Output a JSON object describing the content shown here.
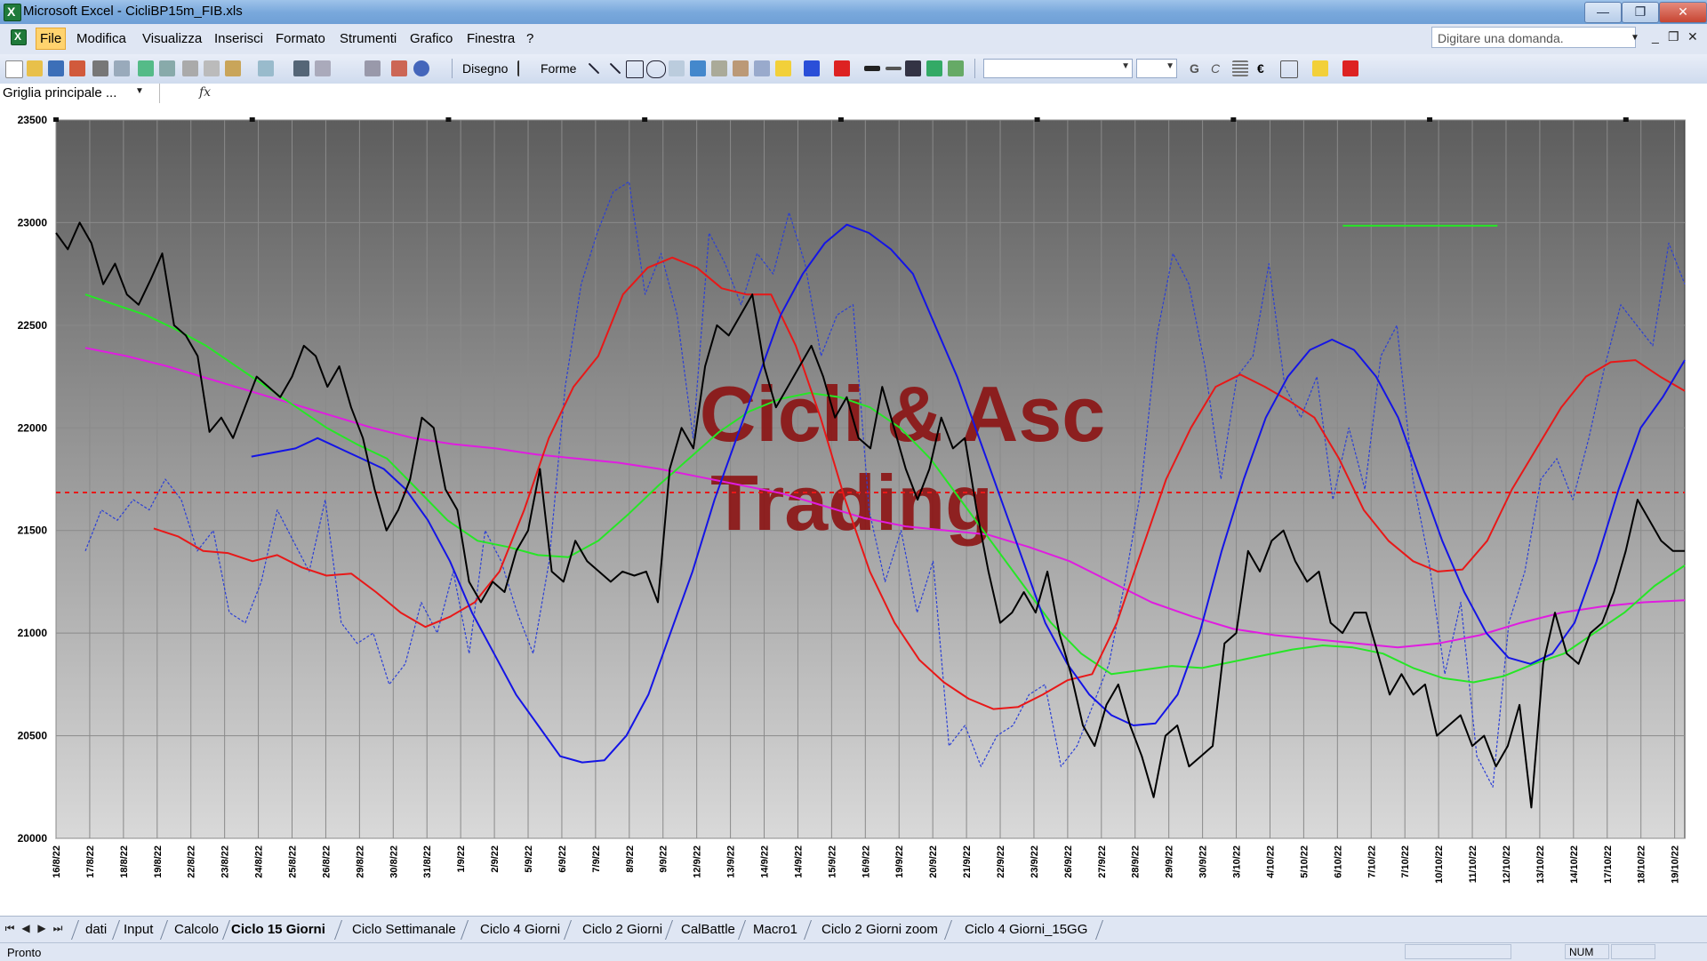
{
  "window": {
    "title": "Microsoft Excel - CicliBP15m_FIB.xls",
    "minimize": "—",
    "restore": "❐",
    "close": "✕"
  },
  "menu": {
    "items": [
      "File",
      "Modifica",
      "Visualizza",
      "Inserisci",
      "Formato",
      "Strumenti",
      "Grafico",
      "Finestra",
      "?"
    ],
    "help_placeholder": "Digitare una domanda."
  },
  "toolbar": {
    "draw_label": "Disegno",
    "shapes_label": "Forme",
    "bold": "G",
    "italic": "C",
    "euro": "€"
  },
  "formula_bar": {
    "name_box": "Griglia principale ...",
    "fx": "fx"
  },
  "chart_data": {
    "type": "line",
    "ylim": [
      20000,
      23500
    ],
    "yticks": [
      20000,
      20500,
      21000,
      21500,
      22000,
      22500,
      23000,
      23500
    ],
    "xlabels": [
      "16/8/22",
      "17/8/22",
      "18/8/22",
      "19/8/22",
      "22/8/22",
      "23/8/22",
      "24/8/22",
      "25/8/22",
      "26/8/22",
      "29/8/22",
      "30/8/22",
      "31/8/22",
      "1/9/22",
      "2/9/22",
      "5/9/22",
      "6/9/22",
      "7/9/22",
      "8/9/22",
      "9/9/22",
      "12/9/22",
      "13/9/22",
      "14/9/22",
      "14/9/22",
      "15/9/22",
      "16/9/22",
      "19/9/22",
      "20/9/22",
      "21/9/22",
      "22/9/22",
      "23/9/22",
      "26/9/22",
      "27/9/22",
      "28/9/22",
      "29/9/22",
      "30/9/22",
      "3/10/22",
      "4/10/22",
      "5/10/22",
      "6/10/22",
      "7/10/22",
      "7/10/22",
      "10/10/22",
      "11/10/22",
      "12/10/22",
      "13/10/22",
      "14/10/22",
      "17/10/22",
      "18/10/22",
      "19/10/22"
    ],
    "watermark": [
      "Cicli & Asc",
      "Trading"
    ],
    "reference_level": 21685,
    "colors": {
      "price": "#000000",
      "oscillator": "#2b3fd6",
      "blue": "#1414e6",
      "red": "#e81818",
      "green": "#26e626",
      "magenta": "#e01ce0",
      "watermark": "#8b0b0b"
    },
    "grid": true,
    "series": [
      {
        "key": "price",
        "style": "solid",
        "values": [
          22950,
          22870,
          23000,
          22900,
          22700,
          22800,
          22650,
          22600,
          22720,
          22850,
          22500,
          22450,
          22350,
          21980,
          22050,
          21950,
          22100,
          22250,
          22200,
          22150,
          22250,
          22400,
          22350,
          22200,
          22300,
          22100,
          21950,
          21700,
          21500,
          21600,
          21750,
          22050,
          22000,
          21700,
          21600,
          21250,
          21150,
          21250,
          21200,
          21400,
          21500,
          21800,
          21300,
          21250,
          21450,
          21350,
          21300,
          21250,
          21300,
          21280,
          21300,
          21150,
          21800,
          22000,
          21900,
          22300,
          22500,
          22450,
          22550,
          22650,
          22300,
          22100,
          22200,
          22300,
          22400,
          22250,
          22050,
          22150,
          21950,
          21900,
          22200,
          22000,
          21800,
          21650,
          21800,
          22050,
          21900,
          21950,
          21600,
          21300,
          21050,
          21100,
          21200,
          21100,
          21300,
          21000,
          20800,
          20550,
          20450,
          20650,
          20750,
          20550,
          20400,
          20200,
          20500,
          20550,
          20350,
          20400,
          20450,
          20950,
          21000,
          21400,
          21300,
          21450,
          21500,
          21350,
          21250,
          21300,
          21050,
          21000,
          21100,
          21100,
          20900,
          20700,
          20800,
          20700,
          20750,
          20500,
          20550,
          20600,
          20450,
          20500,
          20350,
          20450,
          20650,
          20150,
          20850,
          21100,
          20900,
          20850,
          21000,
          21050,
          21200,
          21400,
          21650,
          21550,
          21450,
          21400,
          21400
        ]
      },
      {
        "key": "oscillator",
        "style": "dashed",
        "values": [
          21400,
          21600,
          21550,
          21650,
          21600,
          21750,
          21650,
          21400,
          21500,
          21100,
          21050,
          21250,
          21600,
          21450,
          21300,
          21650,
          21050,
          20950,
          21000,
          20750,
          20850,
          21150,
          21000,
          21300,
          20900,
          21500,
          21350,
          21100,
          20900,
          21350,
          22200,
          22700,
          22950,
          23150,
          23200,
          22650,
          22850,
          22550,
          21950,
          22950,
          22800,
          22600,
          22850,
          22750,
          23050,
          22800,
          22350,
          22550,
          22600,
          21600,
          21250,
          21500,
          21100,
          21350,
          20450,
          20550,
          20350,
          20500,
          20550,
          20700,
          20750,
          20350,
          20450,
          20650,
          20850,
          21250,
          21700,
          22450,
          22850,
          22700,
          22300,
          21750,
          22250,
          22350,
          22800,
          22200,
          22050,
          22250,
          21650,
          22000,
          21700,
          22350,
          22500,
          21750,
          21350,
          20800,
          21150,
          20400,
          20250,
          21050,
          21300,
          21750,
          21850,
          21650,
          21950,
          22300,
          22600,
          22500,
          22400,
          22900,
          22700
        ]
      },
      {
        "key": "blue",
        "style": "solid",
        "values": [
          21860,
          21880,
          21900,
          21950,
          21900,
          21850,
          21800,
          21700,
          21550,
          21350,
          21100,
          20900,
          20700,
          20550,
          20400,
          20370,
          20380,
          20500,
          20700,
          21000,
          21300,
          21650,
          21950,
          22250,
          22550,
          22750,
          22900,
          22990,
          22950,
          22870,
          22750,
          22500,
          22250,
          21950,
          21650,
          21350,
          21050,
          20850,
          20700,
          20600,
          20550,
          20560,
          20700,
          21000,
          21400,
          21750,
          22050,
          22250,
          22380,
          22430,
          22380,
          22250,
          22050,
          21750,
          21450,
          21200,
          21000,
          20880,
          20850,
          20900,
          21050,
          21350,
          21700,
          22000,
          22150,
          22330
        ]
      },
      {
        "key": "red",
        "style": "solid",
        "values": [
          21510,
          21470,
          21400,
          21390,
          21350,
          21380,
          21320,
          21280,
          21290,
          21200,
          21100,
          21030,
          21080,
          21150,
          21300,
          21600,
          21950,
          22200,
          22350,
          22650,
          22780,
          22830,
          22780,
          22680,
          22650,
          22650,
          22400,
          22050,
          21650,
          21300,
          21050,
          20870,
          20760,
          20680,
          20630,
          20640,
          20700,
          20770,
          20800,
          21050,
          21400,
          21750,
          22000,
          22200,
          22260,
          22200,
          22130,
          22050,
          21850,
          21600,
          21450,
          21350,
          21300,
          21310,
          21450,
          21700,
          21900,
          22100,
          22250,
          22320,
          22330,
          22250,
          22180
        ]
      },
      {
        "key": "green",
        "style": "solid",
        "values": [
          22650,
          22600,
          22550,
          22480,
          22400,
          22300,
          22200,
          22100,
          22000,
          21920,
          21850,
          21700,
          21550,
          21450,
          21420,
          21380,
          21370,
          21450,
          21580,
          21720,
          21850,
          21980,
          22080,
          22140,
          22170,
          22150,
          22100,
          22000,
          21850,
          21650,
          21450,
          21250,
          21050,
          20900,
          20800,
          20820,
          20840,
          20830,
          20860,
          20890,
          20920,
          20940,
          20930,
          20900,
          20830,
          20780,
          20760,
          20790,
          20850,
          20900,
          21000,
          21100,
          21230,
          21330
        ]
      },
      {
        "key": "green_short",
        "style": "solid",
        "values": [
          22985,
          22985
        ]
      },
      {
        "key": "magenta",
        "style": "solid",
        "values": [
          22390,
          22350,
          22300,
          22240,
          22180,
          22120,
          22060,
          22000,
          21950,
          21920,
          21900,
          21870,
          21850,
          21830,
          21800,
          21760,
          21720,
          21680,
          21620,
          21560,
          21520,
          21500,
          21480,
          21420,
          21350,
          21250,
          21150,
          21080,
          21020,
          20990,
          20970,
          20950,
          20930,
          20950,
          20990,
          21050,
          21100,
          21130,
          21150,
          21160
        ]
      }
    ]
  },
  "sheet_tabs": {
    "nav": [
      "⏮",
      "◀",
      "▶",
      "⏭"
    ],
    "items": [
      "dati",
      "Input",
      "Calcolo",
      "Ciclo 15 Giorni",
      "Ciclo Settimanale",
      "Ciclo 4 Giorni",
      "Ciclo 2 Giorni",
      "CalBattle",
      "Macro1",
      "Ciclo 2 Giorni zoom",
      "Ciclo 4 Giorni_15GG"
    ],
    "active": "Ciclo 15 Giorni"
  },
  "status": {
    "text": "Pronto",
    "num": "NUM"
  }
}
